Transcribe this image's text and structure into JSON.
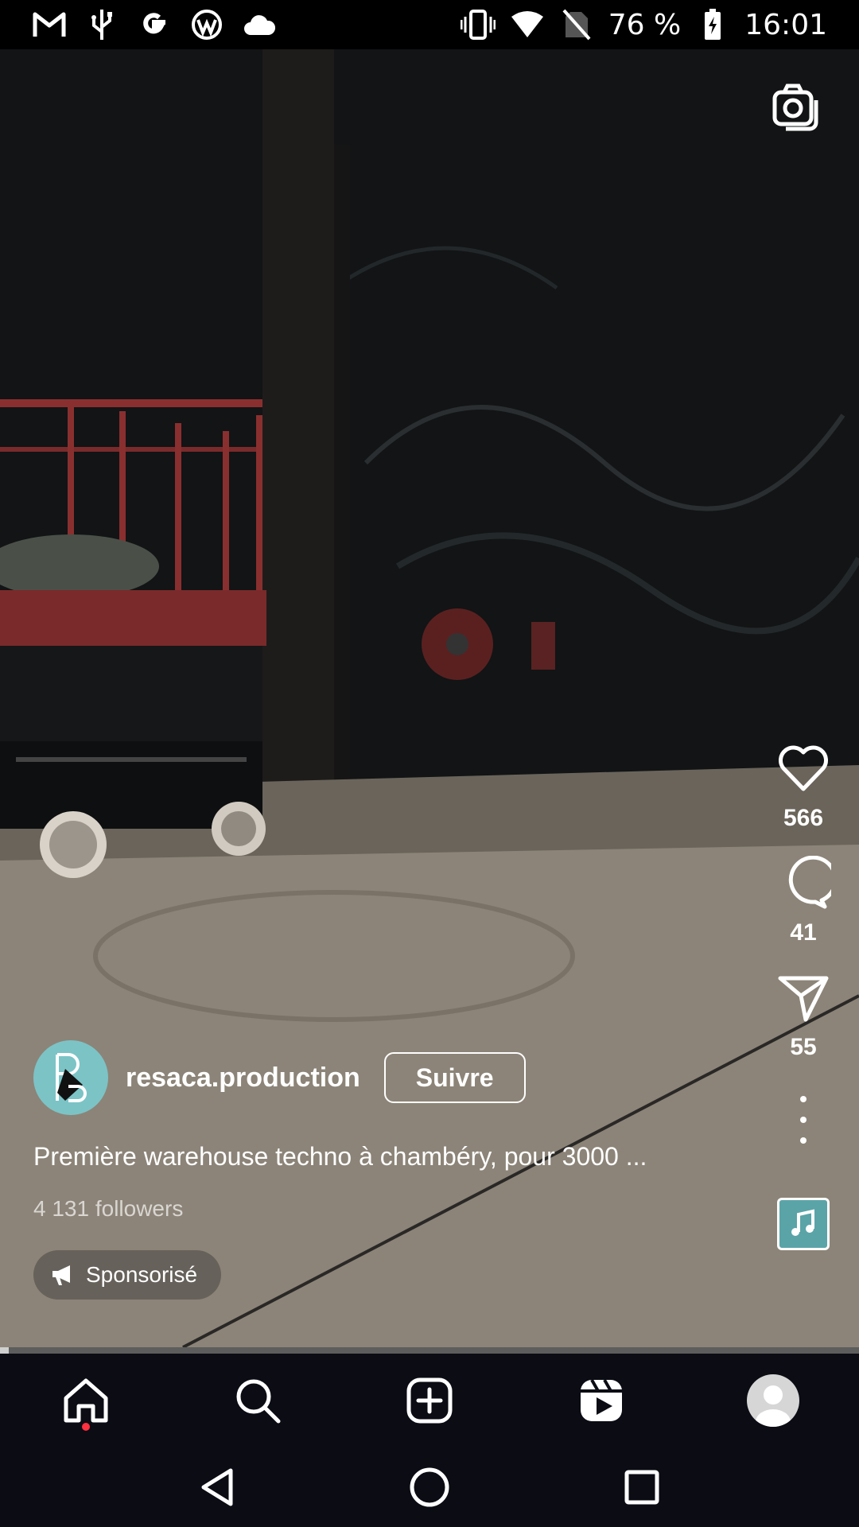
{
  "status_bar": {
    "battery": "76 %",
    "time": "16:01",
    "left_icons": [
      "gmail-icon",
      "usb-icon",
      "google-icon",
      "wordpress-icon",
      "cloud-icon"
    ],
    "right_icons": [
      "vibrate-icon",
      "wifi-icon",
      "no-sim-icon",
      "battery-charging-icon"
    ]
  },
  "reel": {
    "username": "resaca.production",
    "follow_label": "Suivre",
    "caption": "Première warehouse techno à chambéry, pour 3000 ...",
    "followers": "4 131 followers",
    "sponsored_label": "Sponsorisé",
    "likes": "566",
    "comments": "41",
    "shares": "55",
    "progress": 0.01
  },
  "bottom_nav": {
    "items": [
      "home-icon",
      "search-icon",
      "create-icon",
      "reels-icon",
      "profile-icon"
    ],
    "active": "home"
  },
  "colors": {
    "nav_background": "#0b0c14",
    "notification_dot": "#ff3040",
    "avatar_teal": "#7cc3c6"
  }
}
